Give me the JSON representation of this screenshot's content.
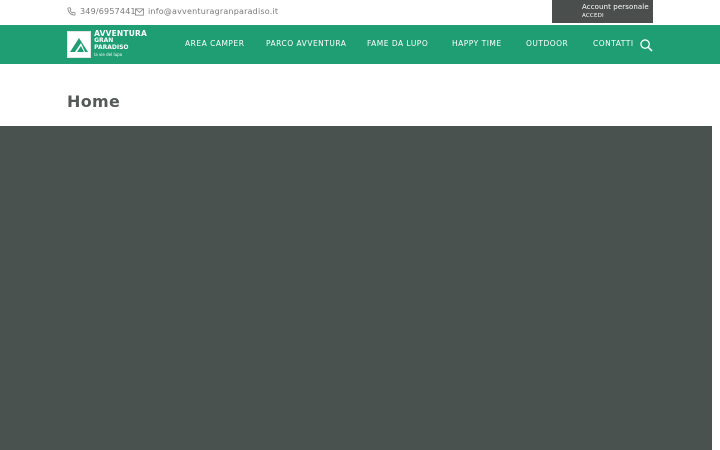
{
  "topbar": {
    "phone": "349/6957441",
    "email": "info@avventuragranparadiso.it",
    "account_title": "Account personale",
    "account_login": "ACCEDI"
  },
  "logo": {
    "line1": "AVVENTURA",
    "line2": "GRAN PARADISO",
    "line3": "la vie del lupo"
  },
  "nav": {
    "items": [
      {
        "label": "AREA CAMPER"
      },
      {
        "label": "PARCO AVVENTURA"
      },
      {
        "label": "FAME DA LUPO"
      },
      {
        "label": "HAPPY TIME"
      },
      {
        "label": "OUTDOOR"
      },
      {
        "label": "CONTATTI"
      }
    ],
    "search_icon": "search-icon"
  },
  "page": {
    "title": "Home"
  },
  "colors": {
    "brand_green": "#1f9e74",
    "dark_gray": "#4a524f",
    "account_bg": "#4a4f4d"
  }
}
